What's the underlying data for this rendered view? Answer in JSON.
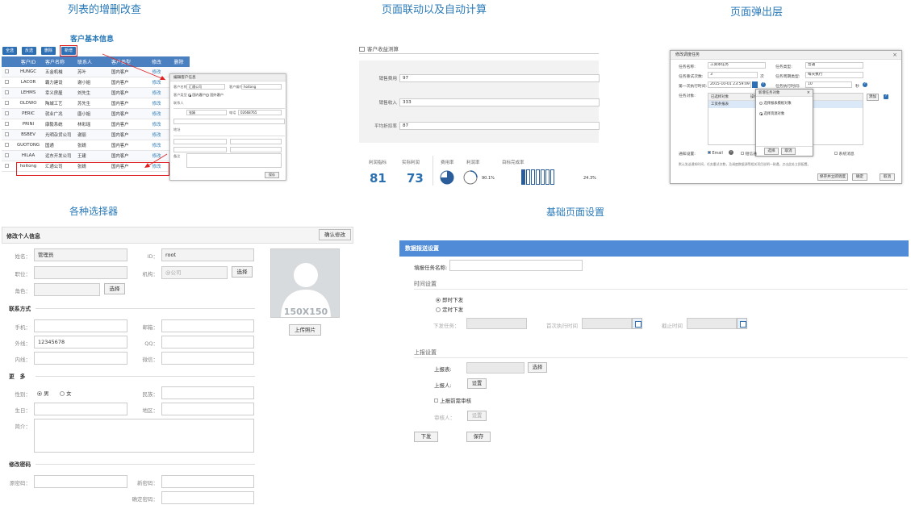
{
  "sections": {
    "crud": "列表的增删改查",
    "linkage": "页面联动以及自动计算",
    "popup": "页面弹出层",
    "selectors": "各种选择器",
    "settings": "基础页面设置"
  },
  "crud": {
    "caption": "客户基本信息",
    "toolbar": [
      "全选",
      "反选",
      "删除",
      "新增"
    ],
    "columns": [
      "客户ID",
      "客户名称",
      "联系人",
      "客户类型",
      "修改",
      "删除"
    ],
    "rows": [
      {
        "id": "HUNGC",
        "name": "五金机械",
        "contact": "苏叶",
        "type": "国内客户",
        "edit": "修改"
      },
      {
        "id": "LACOR",
        "name": "霸力建设",
        "contact": "谢小姐",
        "type": "国内客户",
        "edit": "修改"
      },
      {
        "id": "LEHMS",
        "name": "幸义房屋",
        "contact": "刘先生",
        "type": "国内客户",
        "edit": "修改"
      },
      {
        "id": "OLDWO",
        "name": "陶城工艺",
        "contact": "苏先生",
        "type": "国内客户",
        "edit": "修改"
      },
      {
        "id": "PERIC",
        "name": "就业广兆",
        "contact": "唐小姐",
        "type": "国内客户",
        "edit": "修改"
      },
      {
        "id": "PRINI",
        "name": "康毅系统",
        "contact": "林彩瑶",
        "type": "国内客户",
        "edit": "修改"
      },
      {
        "id": "BSBEV",
        "name": "光明杂货公司",
        "contact": "谢丽",
        "type": "国内客户",
        "edit": "修改"
      },
      {
        "id": "GUOTONG",
        "name": "国通",
        "contact": "张婧",
        "type": "国内客户",
        "edit": "修改"
      },
      {
        "id": "HILAA",
        "name": "远东开发公司",
        "contact": "王建",
        "type": "国内客户",
        "edit": "修改"
      },
      {
        "id": "hoitong",
        "name": "汇通公司",
        "contact": "张婧",
        "type": "国内客户",
        "edit": "修改"
      }
    ],
    "popup": {
      "title": "编辑客户信息",
      "fields": [
        "客户名称",
        "客户编号",
        "客户类型",
        "联系人",
        "电话",
        "地址",
        "备注"
      ],
      "radio_a": "国内客户",
      "radio_b": "国外客户",
      "name_value": "汇通公司",
      "code_value": "hoitong",
      "contact_value": "张婧",
      "phone_value": "02668765",
      "save": "保存"
    }
  },
  "linkage": {
    "header": "客户收益测算",
    "rows": [
      {
        "label": "销售费用",
        "value": "97"
      },
      {
        "label": "销售收入",
        "value": "333"
      },
      {
        "label": "平均折扣率",
        "value": "87"
      }
    ],
    "kpi_labels": [
      "利润指标",
      "实际利润",
      "费用率",
      "利润率",
      "目标完成率"
    ],
    "kpi_values": [
      "81",
      "73"
    ],
    "ratio_text": "90.1%",
    "completion_text": "24.3%",
    "completion_fraction": 0.243
  },
  "popup": {
    "title": "修改调度任务",
    "close": "×",
    "labels": [
      "任务名称:",
      "任务类型:",
      "任务重试次数:",
      "任务周期类型:",
      "第一次执行时间:",
      "任务执行时间:",
      "任务对象:"
    ],
    "values": {
      "name": "工资条任务",
      "type": "普通",
      "retry": "3",
      "retry_unit": "次",
      "cycle": "每天执行",
      "first_time": "2015-10-01 23:59:09",
      "exec_time": "10",
      "exec_unit": "秒"
    },
    "table_header": "已选择对象",
    "table_header2": "操作",
    "table_row": "工资条报表",
    "inner_dialog_title": "新增任务对象",
    "inner_options": [
      "选择报表模板对象",
      "选择资源对象"
    ],
    "inner_buttons": [
      "选择",
      "取消"
    ],
    "edit_button": "添加",
    "notify_label": "通知设置:",
    "notify_options": [
      "Email",
      "短信通",
      "系统消息"
    ],
    "note": "默认发送通知时间，任务重试次数，及调度数据源等相关项目说明一致遇，点击此处立即配置。",
    "footer_buttons": [
      "保存并立即调度",
      "确定",
      "取消"
    ]
  },
  "selectors": {
    "header": "修改个人信息",
    "confirm": "确认修改",
    "name_label": "姓名：",
    "name_value": "管理员",
    "id_label": "ID：",
    "id_value": "root",
    "job_label": "职位：",
    "org_label": "机构：",
    "org_value": "@公司",
    "role_label": "角色：",
    "select": "选择",
    "photo_text": "150X150",
    "upload": "上传照片",
    "contact_section": "联系方式",
    "mobile": "手机：",
    "email": "邮箱：",
    "ext": "外线：",
    "ext_value": "12345678",
    "qq": "QQ：",
    "inner": "内线：",
    "wechat": "微信：",
    "more_section": "更　多",
    "gender": "性别：",
    "male": "男",
    "female": "女",
    "nation": "民族：",
    "birth": "生日：",
    "region": "地区：",
    "bio": "简介：",
    "pwd_section": "修改密码",
    "old_pwd": "原密码：",
    "new_pwd": "新密码：",
    "confirm_pwd": "确定密码："
  },
  "settings": {
    "header": "数据报送设置",
    "task_name": "填报任务名称:",
    "time_group": "时间设置",
    "opt_now": "即时下发",
    "opt_timed": "定时下发",
    "dispatch_task": "下发任务：",
    "first_exec": "首次执行时间",
    "deadline": "截止时间",
    "report_group": "上报设置",
    "report_table": "上报表:",
    "select": "选择",
    "reporter": "上报人:",
    "set": "设置",
    "review": "上报前需审核",
    "reviewer": "审核人：",
    "dispatch": "下发",
    "save": "保存"
  },
  "colors": {
    "accent": "#2a7ab8",
    "header_blue": "#4a7fc0",
    "red": "#e02020"
  }
}
